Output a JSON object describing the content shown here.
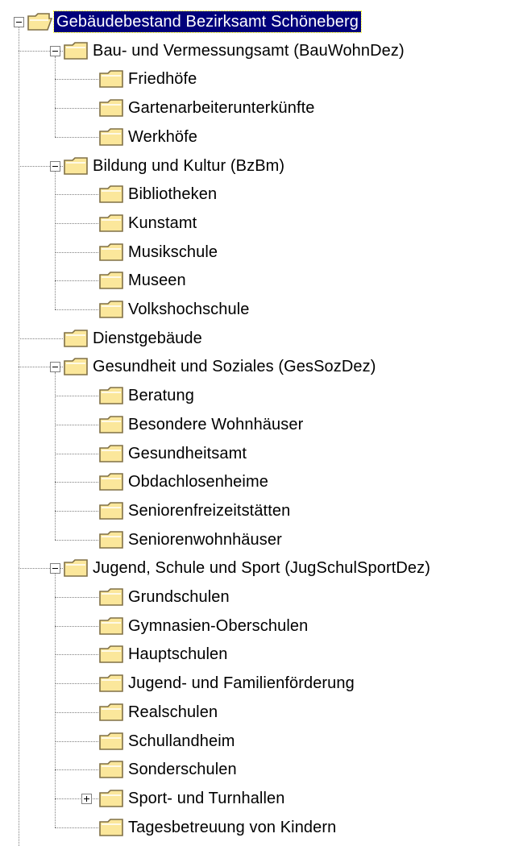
{
  "tree": {
    "root": {
      "label": "Gebäudebestand Bezirksamt Schöneberg",
      "selected": true,
      "expanded": true,
      "icon": "open-folder-icon"
    },
    "nodes": [
      {
        "label": "Bau- und Vermessungsamt (BauWohnDez)",
        "level": 1,
        "expander": "minus"
      },
      {
        "label": "Friedhöfe",
        "level": 2,
        "expander": null
      },
      {
        "label": "Gartenarbeiterunterkünfte",
        "level": 2,
        "expander": null
      },
      {
        "label": "Werkhöfe",
        "level": 2,
        "expander": null
      },
      {
        "label": "Bildung und Kultur (BzBm)",
        "level": 1,
        "expander": "minus"
      },
      {
        "label": "Bibliotheken",
        "level": 2,
        "expander": null
      },
      {
        "label": "Kunstamt",
        "level": 2,
        "expander": null
      },
      {
        "label": "Musikschule",
        "level": 2,
        "expander": null
      },
      {
        "label": "Museen",
        "level": 2,
        "expander": null
      },
      {
        "label": "Volkshochschule",
        "level": 2,
        "expander": null
      },
      {
        "label": "Dienstgebäude",
        "level": 1,
        "expander": null
      },
      {
        "label": "Gesundheit und Soziales (GesSozDez)",
        "level": 1,
        "expander": "minus"
      },
      {
        "label": "Beratung",
        "level": 2,
        "expander": null
      },
      {
        "label": "Besondere Wohnhäuser",
        "level": 2,
        "expander": null
      },
      {
        "label": "Gesundheitsamt",
        "level": 2,
        "expander": null
      },
      {
        "label": "Obdachlosenheime",
        "level": 2,
        "expander": null
      },
      {
        "label": "Seniorenfreizeitstätten",
        "level": 2,
        "expander": null
      },
      {
        "label": "Seniorenwohnhäuser",
        "level": 2,
        "expander": null
      },
      {
        "label": "Jugend, Schule und Sport (JugSchulSportDez)",
        "level": 1,
        "expander": "minus"
      },
      {
        "label": "Grundschulen",
        "level": 2,
        "expander": null
      },
      {
        "label": "Gymnasien-Oberschulen",
        "level": 2,
        "expander": null
      },
      {
        "label": "Hauptschulen",
        "level": 2,
        "expander": null
      },
      {
        "label": "Jugend- und Familienförderung",
        "level": 2,
        "expander": null
      },
      {
        "label": "Realschulen",
        "level": 2,
        "expander": null
      },
      {
        "label": "Schullandheim",
        "level": 2,
        "expander": null
      },
      {
        "label": "Sonderschulen",
        "level": 2,
        "expander": null
      },
      {
        "label": "Sport- und Turnhallen",
        "level": 2,
        "expander": "plus"
      },
      {
        "label": "Tagesbetreuung von Kindern",
        "level": 2,
        "expander": null
      }
    ]
  },
  "colors": {
    "selection": "#00007b",
    "folder_fill": "#fbe79b",
    "folder_stroke": "#807046",
    "tree_lines": "#808080"
  }
}
